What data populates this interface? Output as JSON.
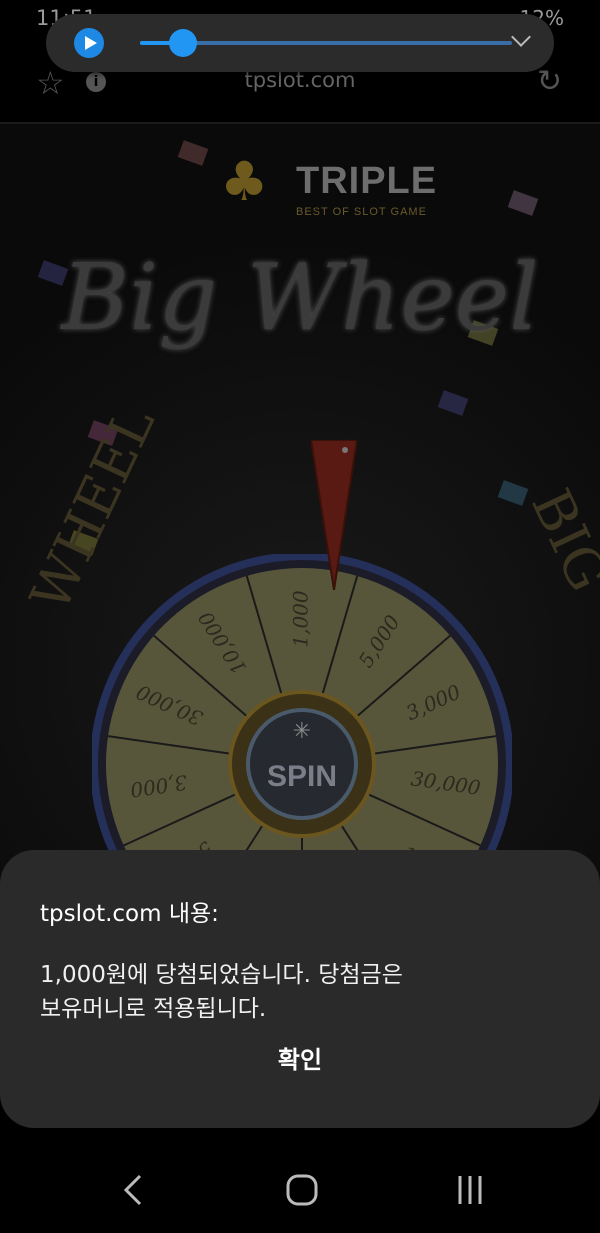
{
  "status": {
    "time": "11:51",
    "battery": "12%"
  },
  "media": {
    "progress": 0.115
  },
  "browser": {
    "url": "tpslot.com"
  },
  "game": {
    "brand": "TRIPLE",
    "brand_tagline": "BEST OF SLOT GAME",
    "title": "Big Wheel",
    "side_left": "WHEEL",
    "side_right": "BIG",
    "spin_label": "SPIN",
    "wheel_segments": [
      "1,000",
      "5,000",
      "3,000",
      "30,000",
      "10",
      "",
      "",
      "50,0",
      "3,000",
      "30,000",
      "10,000"
    ]
  },
  "dialog": {
    "title": "tpslot.com 내용:",
    "message_line1": "1,000원에 당첨되었습니다. 당첨금은",
    "message_line2": "보유머니로 적용됩니다.",
    "ok_label": "확인"
  },
  "colors": {
    "accent": "#2196f3",
    "dialog_bg": "#2a2a2a"
  }
}
